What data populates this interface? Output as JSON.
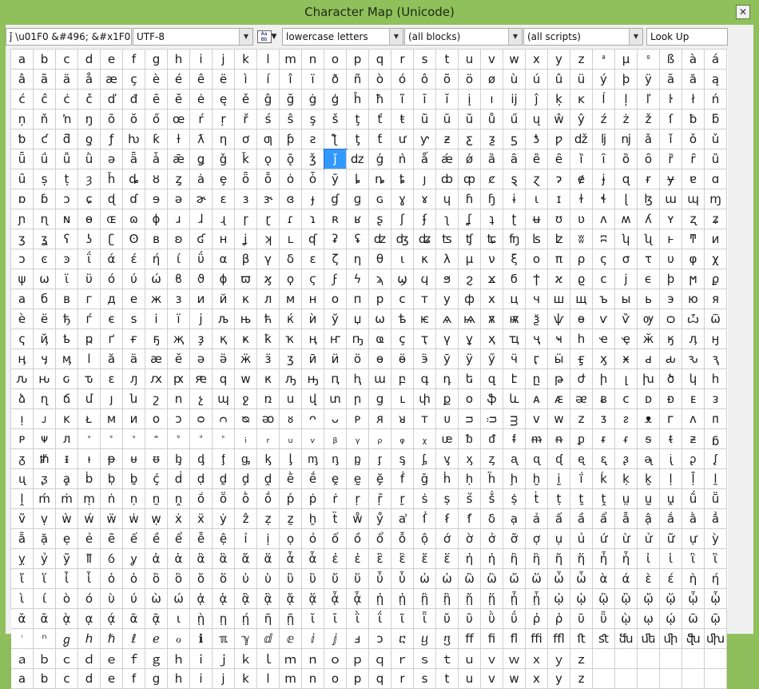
{
  "window": {
    "title": "Character Map (Unicode)",
    "close_glyph": "✕"
  },
  "toolbar": {
    "char_info": "ǰ  \\u01F0  &#496;  &#x1F0;",
    "encoding": "UTF-8",
    "font_icon_text": "Aa Bb",
    "filter_group": "lowercase letters",
    "block": "(all blocks)",
    "script": "(all scripts)",
    "lookup_placeholder": "Look Up"
  },
  "selected_char": "ǰ",
  "small_chars": [
    "ª",
    "º",
    "ᵃ",
    "ᵄ",
    "ᵅ",
    "ᵆ",
    "ᵇ",
    "ᵈ",
    "ᵉ",
    "ⁱ"
  ],
  "rows": [
    "a b c d e f g h i j k l m n o p q r s t u v w x y z ª µ º ß à á",
    "â ã ä å æ ç è é ê ë ì í î ï ð ñ ò ó ô õ ö ø ù ú û ü ý þ ÿ ā ă ą",
    "ć ĉ ċ č ď đ ē ĕ ė ę ě ĝ ğ ġ ģ ĥ ħ ĩ ī ĭ į ı ĳ ĵ ķ ĸ ĺ ļ ľ ŀ ł ń",
    "ņ ň ŉ ŋ ō ŏ ő œ ŕ ŗ ř ś ŝ ş š ţ ť ŧ ũ ū ŭ ů ű ų ŵ ŷ ź ż ž ſ ƀ ƃ",
    "ƅ ƈ ƌ ƍ ƒ ƕ ƙ ƚ ƛ ƞ ơ ƣ ƥ ƨ ƪ ƫ ƭ ư ƴ ƶ ƹ ƺ ƽ ƾ ƿ ǆ ǉ ǌ ǎ ǐ ǒ ǔ",
    "ǖ ǘ ǚ ǜ ǝ ǟ ǡ ǣ ǥ ǧ ǩ ǫ ǭ ǯ ǰ ǳ ǵ ǹ ǻ ǽ ǿ ȁ ȃ ȅ ȇ ȉ ȋ ȍ ȏ ȑ ȓ ȕ",
    "ȗ ș ț ȝ ȟ ȡ ȣ ȥ ȧ ȩ ȫ ȭ ȯ ȱ ȳ ȴ ȵ ȶ ȷ ȸ ȹ ȼ ȿ ɀ ɂ ɇ ɉ ɋ ɍ ɏ ɐ ɑ",
    "ɒ ɓ ɔ ɕ ɖ ɗ ɘ ə ɚ ɛ ɜ ɝ ɞ ɟ ɠ ɡ ɢ ɣ ɤ ɥ ɦ ɧ ɨ ɩ ɪ ɫ ɬ ɭ ɮ ɯ ɰ ɱ",
    "ɲ ɳ ɴ ɵ ɶ ɷ ɸ ɹ ɺ ɻ ɼ ɽ ɾ ɿ ʀ ʁ ʂ ʃ ʄ ʅ ʆ ʇ ʈ ʉ ʊ ʋ ʌ ʍ ʎ ʏ ʐ ʑ",
    "ʒ ʓ ʕ ʖ ʗ ʘ ʙ ʚ ʛ ʜ ʝ ʞ ʟ ʠ ʡ ʢ ʣ ʤ ʥ ʦ ʧ ʨ ʩ ʪ ʫ ʬ ʭ ʮ ʯ ͱ ͳ ͷ",
    "ͻ ͼ ͽ ΐ ά έ ή ί ΰ α β γ δ ε ζ η θ ι κ λ μ ν ξ ο π ρ ς σ τ υ φ χ",
    "ψ ω ϊ ϋ ό ύ ώ ϐ ϑ ϕ ϖ ϗ ϙ ϛ ϝ ϟ ϡ ϣ ϥ ϧ ϩ ϫ ϭ ϯ ϰ ϱ ϲ ϳ ϵ ϸ ϻ ϼ",
    "а б в г д е ж з и й к л м н о п р с т у ф х ц ч ш щ ъ ы ь э ю я",
    "ѐ ё ђ ѓ є ѕ і ї ј љ њ ћ ќ ѝ ў џ ѡ ѣ ѥ ѧ ѩ ѫ ѭ ѯ ѱ ѳ ѵ ѷ ѹ ѻ ѽ ѿ",
    "ҁ ҋ ҍ ҏ ґ ғ ҕ җ ҙ қ ҝ ҟ ҡ ң ҥ ҧ ҩ ҫ ҭ ү ұ ҳ ҵ ҷ ҹ һ ҽ ҿ ӂ ӄ ӆ ӈ",
    "ӊ ӌ ӎ ӏ ӑ ӓ ӕ ӗ ә ӛ ӝ ӟ ӡ ӣ ӥ ӧ ө ӫ ӭ ӯ ӱ ӳ ӵ ӷ ӹ ӻ ӽ ӿ ԁ ԃ ԅ ԇ",
    "ԉ ԋ ԍ ԏ ԑ ԓ ԕ ԗ ԙ ԛ ԝ ԟ ԡ ԣ ԥ ԧ ա բ գ դ ե զ է ը թ ժ ի լ խ ծ կ հ",
    "ձ ղ ճ մ յ ն շ ո չ պ ջ ռ ս վ տ ր ց ւ փ ք օ ֆ և ᴀ ᴁ ᴂ ᴃ ᴄ ᴅ ᴆ ᴇ ᴈ",
    "ᴉ ᴊ ᴋ ᴌ ᴍ ᴎ ᴏ ᴐ ᴑ ᴒ ᴓ ᴔ ᴕ ᴖ ᴗ ᴘ ᴙ ᴚ ᴛ ᴜ ᴝ ᴞ ᴟ ᴠ ᴡ ᴢ ᴣ ᴤ ᴥ ᴦ ᴧ ᴨ",
    "ᴩ ᴪ ᴫ ᵃ ᵄ ᵅ ᵆ ᵇ ᵈ ᵉ ᵢ ᵣ ᵤ ᵥ ᵦ ᵧ ᵨ ᵩ ᵪ ᵫ ᵬ ᵭ ᵮ ᵯ ᵰ ᵱ ᵲ ᵳ ᵴ ᵵ ᵶ ᵷ",
    "ᵹ ᵺ ᵻ ᵼ ᵽ ᵾ ᵿ ᶀ ᶁ ᶂ ᶃ ᶄ ᶅ ᶆ ᶇ ᶈ ᶉ ᶊ ᶋ ᶌ ᶍ ᶎ ᶏ ᶐ ᶑ ᶒ ᶓ ᶔ ᶕ ᶖ ᶗ ᶘ",
    "ᶙ ᶚ ḁ ḃ ḅ ḇ ḉ ḋ ḍ ḏ ḑ ḓ ḕ ḗ ḙ ḛ ḝ ḟ ḡ ḣ ḥ ḧ ḩ ḫ ḭ ḯ ḱ ḳ ḵ ḷ ḹ ḻ",
    "ḽ ḿ ṁ ṃ ṅ ṇ ṉ ṋ ṍ ṏ ṑ ṓ ṕ ṗ ṙ ṛ ṝ ṟ ṡ ṣ ṥ ṧ ṩ ṫ ṭ ṯ ṱ ṳ ṵ ṷ ṹ ṻ",
    "ṽ ṿ ẁ ẃ ẅ ẇ ẉ ẋ ẍ ẏ ẑ ẓ ẕ ẖ ẗ ẘ ẙ ẚ ẛ ẜ ẝ ẟ ạ ả ấ ầ ẩ ẫ ậ ắ ằ ẳ",
    "ẵ ặ ẹ ẻ ẽ ế ề ể ễ ệ ỉ ị ọ ỏ ố ồ ổ ỗ ộ ớ ờ ở ỡ ợ ụ ủ ứ ừ ử ữ ự ỳ",
    "ỵ ỷ ỹ ỻ ỽ ỿ ἀ ἁ ἂ ἃ ἄ ἅ ἆ ἇ ἐ ἑ ἒ ἓ ἔ ἕ ἠ ἡ ἢ ἣ ἤ ἥ ἦ ἧ ἰ ἱ ἲ ἳ",
    "ἴ ἵ ἶ ἷ ὀ ὁ ὂ ὃ ὄ ὅ ὐ ὑ ὒ ὓ ὔ ὕ ὖ ὗ ὠ ὡ ὢ ὣ ὤ ὥ ὦ ὧ ὰ ά ὲ έ ὴ ή",
    "ὶ ί ὸ ό ὺ ύ ὼ ώ ᾀ ᾁ ᾂ ᾃ ᾄ ᾅ ᾆ ᾇ ᾐ ᾑ ᾒ ᾓ ᾔ ᾕ ᾖ ᾗ ᾠ ᾡ ᾢ ᾣ ᾤ ᾥ ᾦ ᾧ",
    "ᾰ ᾱ ᾲ ᾳ ᾴ ᾶ ᾷ ι ῂ ῃ ῄ ῆ ῇ ῐ ῑ ῒ ΐ ῖ ῗ ῠ ῡ ῢ ΰ ῤ ῥ ῦ ῧ ῲ ῳ ῴ ῶ ῷ",
    "ⁱ ⁿ ℊ ℎ ℏ ℓ ℯ ℴ ℹ ℼ ℽ ⅆ ⅇ ⅈ ⅉ ⅎ ↄ ⴀ ⴁ ⴂ ﬀ ﬁ ﬂ ﬃ ﬄ ﬅ ﬆ ﬓ ﬔ ﬕ ﬖ ﬗ",
    "ａ ｂ ｃ ｄ ｅ ｆ ｇ ｈ ｉ ｊ ｋ ｌ ｍ ｎ ｏ ｐ ｑ ｒ ｓ ｔ ｕ ｖ ｗ ｘ ｙ ｚ",
    "a b c d e f g h i j k l m n o p q r s t u v w x y z"
  ]
}
